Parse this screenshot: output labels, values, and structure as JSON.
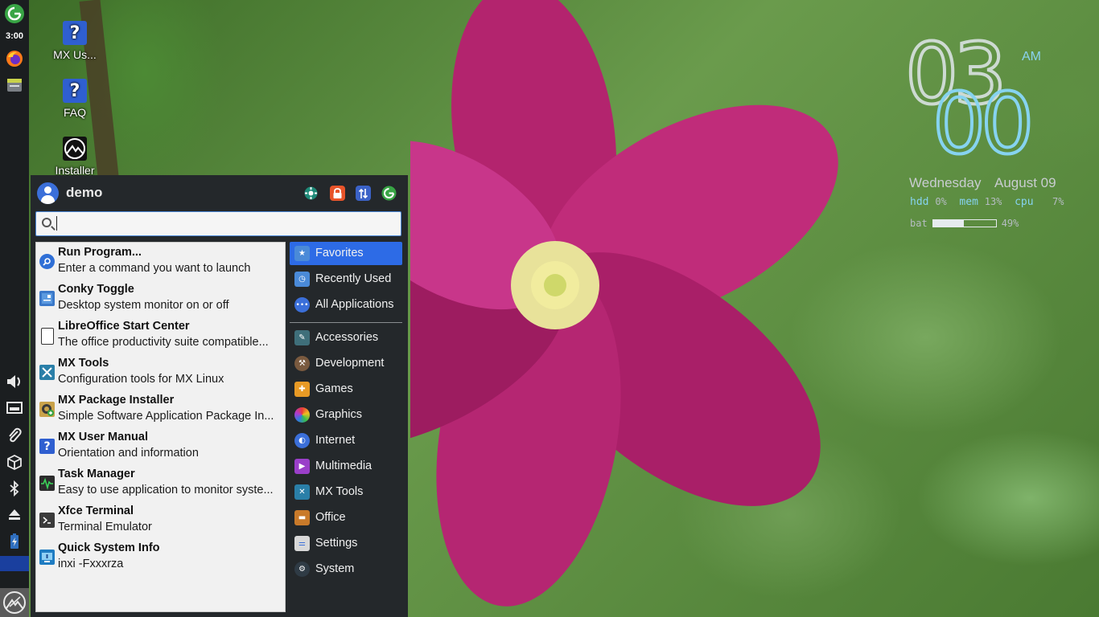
{
  "panel": {
    "clock": "3:00"
  },
  "desktop": {
    "icons": [
      {
        "label": "MX Us...",
        "icon": "question-icon"
      },
      {
        "label": "FAQ",
        "icon": "question-icon"
      },
      {
        "label": "Installer",
        "icon": "mx-installer-icon"
      }
    ]
  },
  "conky": {
    "hour": "03",
    "minute": "00",
    "ampm": "AM",
    "day": "Wednesday",
    "date": "August 09",
    "hdd_label": "hdd",
    "hdd_value": "0%",
    "mem_label": "mem",
    "mem_value": "13%",
    "cpu_label": "cpu",
    "cpu_value": "7%",
    "bat_label": "bat",
    "bat_value": "49%",
    "bat_level": 0.49,
    "colors": {
      "minute": "#86d3f0",
      "label": "#86d3f0",
      "text": "#c8ccd0"
    }
  },
  "menu": {
    "username": "demo",
    "header_buttons": [
      {
        "name": "settings-manager-button",
        "icon": "settings-gear-icon",
        "color": "#1e8a78"
      },
      {
        "name": "lock-screen-button",
        "icon": "lock-icon",
        "color": "#e8542a"
      },
      {
        "name": "switch-user-button",
        "icon": "switch-user-icon",
        "color": "#3b62c7"
      },
      {
        "name": "log-out-button",
        "icon": "log-out-icon",
        "color": "#38a545"
      }
    ],
    "search": {
      "value": "",
      "placeholder": ""
    },
    "favorites": [
      {
        "title": "Run Program...",
        "desc": "Enter a command you want to launch",
        "icon": "run-program-icon",
        "color": "#2f6fd6"
      },
      {
        "title": "Conky Toggle",
        "desc": "Desktop system monitor on or off",
        "icon": "conky-icon",
        "color": "#3a78c9"
      },
      {
        "title": "LibreOffice Start Center",
        "desc": "The office productivity suite compatible...",
        "icon": "libreoffice-icon",
        "color": "#ffffff"
      },
      {
        "title": "MX Tools",
        "desc": "Configuration tools for MX Linux",
        "icon": "mx-tools-icon",
        "color": "#2a7fa8"
      },
      {
        "title": "MX Package Installer",
        "desc": "Simple Software Application Package In...",
        "icon": "package-installer-icon",
        "color": "#c9a24a"
      },
      {
        "title": "MX User Manual",
        "desc": "Orientation and information",
        "icon": "question-icon",
        "color": "#2f5fd0"
      },
      {
        "title": "Task Manager",
        "desc": "Easy to use application to monitor syste...",
        "icon": "task-manager-icon",
        "color": "#2c2c2c"
      },
      {
        "title": "Xfce Terminal",
        "desc": "Terminal Emulator",
        "icon": "terminal-icon",
        "color": "#3a3a3a"
      },
      {
        "title": "Quick System Info",
        "desc": "inxi -Fxxxrza",
        "icon": "system-info-icon",
        "color": "#1f7cc2"
      }
    ],
    "categories_top": [
      {
        "label": "Favorites",
        "icon": "favorites-folder-icon",
        "color": "#4a8ad8",
        "selected": true
      },
      {
        "label": "Recently Used",
        "icon": "recent-folder-icon",
        "color": "#4a8ad8",
        "selected": false
      },
      {
        "label": "All Applications",
        "icon": "all-apps-icon",
        "color": "#3b6fd9",
        "selected": false
      }
    ],
    "categories": [
      {
        "label": "Accessories",
        "icon": "accessories-icon",
        "color": "#3f6f7a"
      },
      {
        "label": "Development",
        "icon": "development-icon",
        "color": "#7a5a3f"
      },
      {
        "label": "Games",
        "icon": "games-icon",
        "color": "#e89a25"
      },
      {
        "label": "Graphics",
        "icon": "graphics-icon",
        "color": "#d94a8f"
      },
      {
        "label": "Internet",
        "icon": "internet-icon",
        "color": "#3b6fd9"
      },
      {
        "label": "Multimedia",
        "icon": "multimedia-icon",
        "color": "#9a3fc9"
      },
      {
        "label": "MX Tools",
        "icon": "mx-tools-icon",
        "color": "#2a7fa8"
      },
      {
        "label": "Office",
        "icon": "office-icon",
        "color": "#c97a2a"
      },
      {
        "label": "Settings",
        "icon": "settings-icon",
        "color": "#d8d8d8"
      },
      {
        "label": "System",
        "icon": "system-icon",
        "color": "#2f3b45"
      }
    ],
    "selected_color": "#2d6be6"
  }
}
